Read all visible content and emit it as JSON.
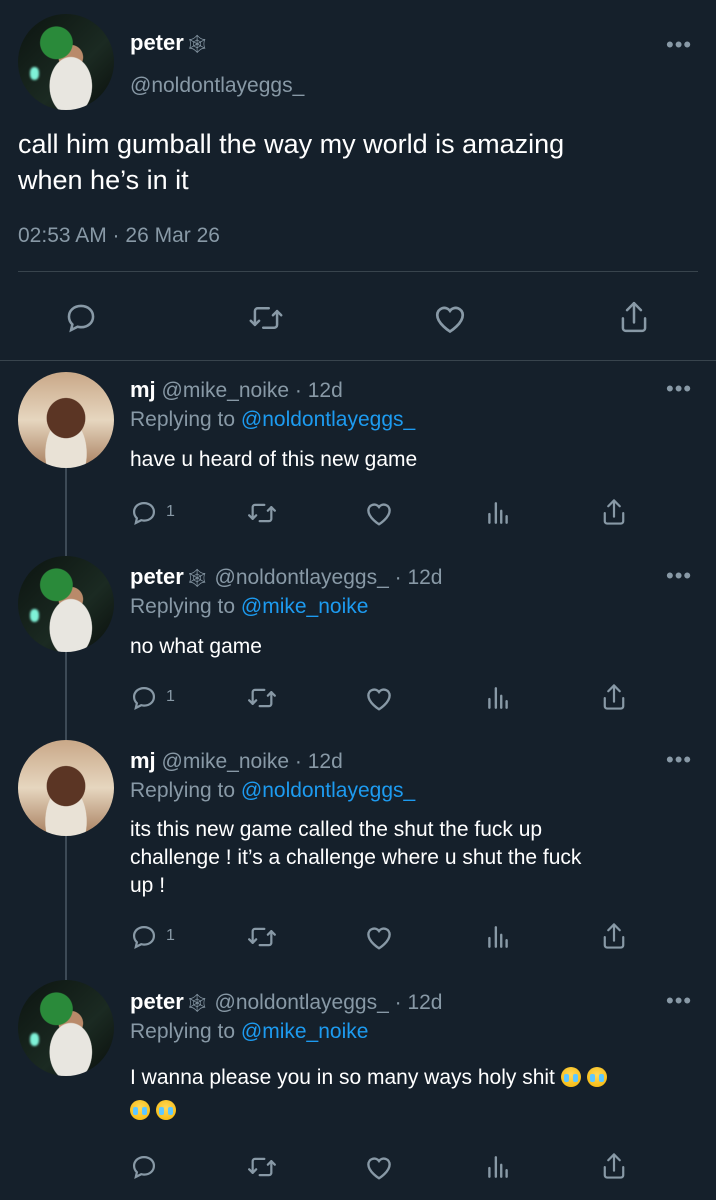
{
  "main_tweet": {
    "display_name": "peter",
    "badge_icon": "spider-web-icon",
    "handle": "@noldontlayeggs_",
    "text_line1": "call him gumball the way my world is amazing",
    "text_line2": "when he’s in it",
    "timestamp": "02:53 AM · 26 Mar 26"
  },
  "replies": [
    {
      "display_name": "mj",
      "handle": "@mike_noike",
      "age": "· 12d",
      "replying_prefix": "Replying to",
      "replying_to": "@noldontlayeggs_",
      "lines": [
        "have u heard of this new game"
      ],
      "reply_count": "1"
    },
    {
      "display_name": "peter",
      "handle": "@noldontlayeggs_",
      "age": "· 12d",
      "replying_prefix": "Replying to",
      "replying_to": "@mike_noike",
      "lines": [
        "no what game"
      ],
      "reply_count": "1"
    },
    {
      "display_name": "mj",
      "handle": "@mike_noike",
      "age": "· 12d",
      "replying_prefix": "Replying to",
      "replying_to": "@noldontlayeggs_",
      "lines": [
        "its this new game called the shut the fuck up",
        "challenge ! it’s a challenge where u shut the fuck",
        "up !"
      ],
      "reply_count": "1"
    },
    {
      "display_name": "peter",
      "handle": "@noldontlayeggs_",
      "age": "· 12d",
      "replying_prefix": "Replying to",
      "replying_to": "@mike_noike",
      "lines": [
        "I wanna please you in so many ways holy shit"
      ],
      "reply_count": ""
    }
  ],
  "colors": {
    "background": "#15202b",
    "muted": "#8899a6",
    "link": "#1d9bf0"
  }
}
